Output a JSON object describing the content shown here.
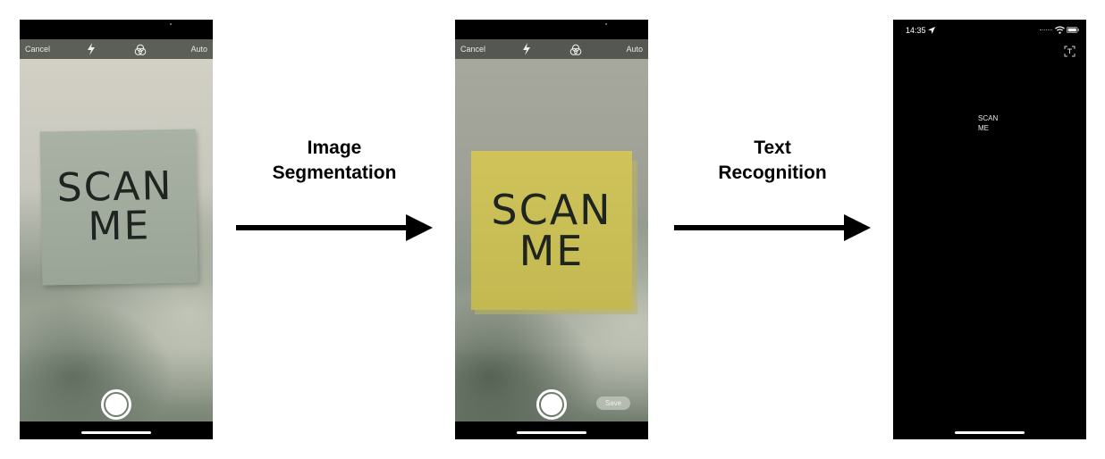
{
  "camera_ui": {
    "cancel_label": "Cancel",
    "auto_label": "Auto",
    "save_label": "Save"
  },
  "sticky_note": {
    "line1": "SCAN",
    "line2": "ME",
    "original_color": "#9fa99b",
    "segmented_color": "#cabd56"
  },
  "steps": [
    {
      "line1": "Image",
      "line2": "Segmentation"
    },
    {
      "line1": "Text",
      "line2": "Recognition"
    }
  ],
  "result_screen": {
    "time": "14:35",
    "recognized_text": "SCAN\nME"
  },
  "icons": [
    "flash-icon",
    "filter-icon",
    "location-icon",
    "wifi-icon",
    "battery-icon",
    "live-text-icon"
  ]
}
